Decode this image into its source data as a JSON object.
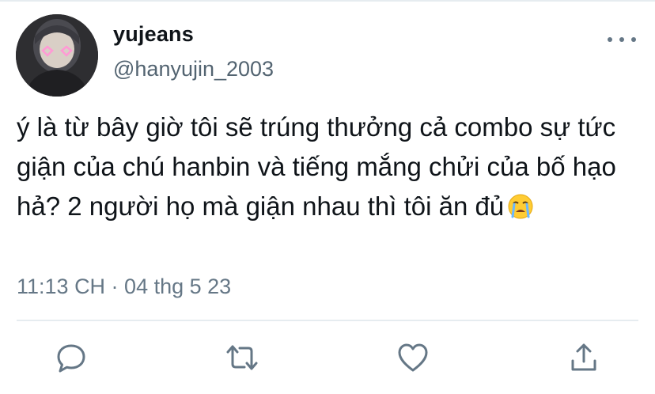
{
  "tweet": {
    "display_name": "yujeans",
    "handle": "@hanyujin_2003",
    "text": "ý là từ bây giờ tôi sẽ trúng thưởng cả combo sự tức giận của chú hanbin và tiếng mắng chửi của bố hạo hả? 2 người họ mà giận nhau thì tôi ăn đủ",
    "emoji": "loudly-crying-face",
    "timestamp": "11:13 CH · 04 thg 5 23"
  },
  "actions": [
    {
      "name": "reply",
      "icon": "comment-bubble-icon"
    },
    {
      "name": "retweet",
      "icon": "retweet-icon"
    },
    {
      "name": "like",
      "icon": "heart-icon"
    },
    {
      "name": "share",
      "icon": "share-icon"
    }
  ],
  "colors": {
    "text": "#0f1419",
    "secondary": "#657786",
    "divider": "#e6ecf0"
  }
}
